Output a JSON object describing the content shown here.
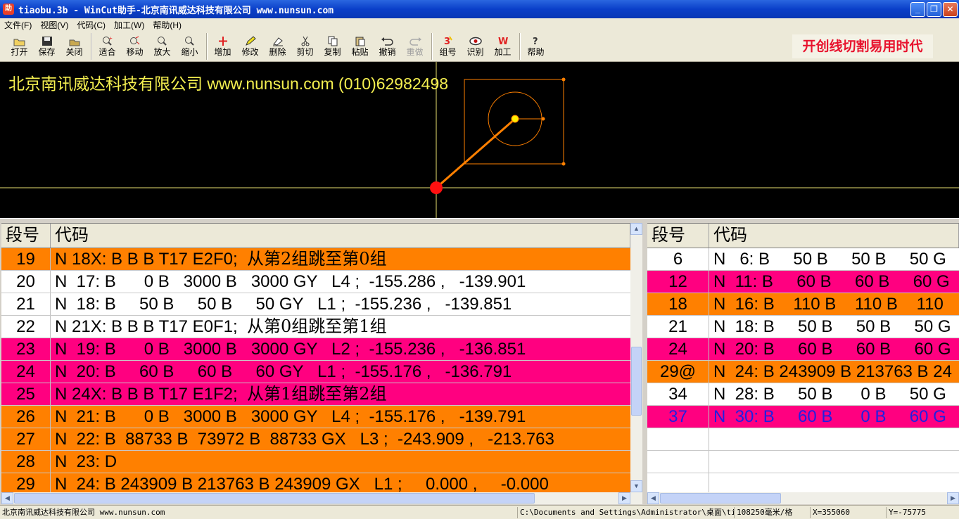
{
  "titlebar": {
    "app_icon": "app-icon",
    "title": "tiaobu.3b - WinCut助手-北京南讯威达科技有限公司 www.nunsun.com",
    "minimize_icon": "minimize-icon",
    "maximize_icon": "restore-icon",
    "close_icon": "close-icon"
  },
  "menu": {
    "items": [
      "文件(F)",
      "视图(V)",
      "代码(C)",
      "加工(W)",
      "帮助(H)"
    ]
  },
  "toolbar": {
    "groups": [
      [
        {
          "label": "打开",
          "icon": "open-folder-icon",
          "enabled": true
        },
        {
          "label": "保存",
          "icon": "save-disk-icon",
          "enabled": true
        },
        {
          "label": "关闭",
          "icon": "close-file-icon",
          "enabled": true
        }
      ],
      [
        {
          "label": "适合",
          "icon": "zoom-fit-icon",
          "enabled": true
        },
        {
          "label": "移动",
          "icon": "pan-hand-icon",
          "enabled": true
        },
        {
          "label": "放大",
          "icon": "zoom-in-icon",
          "enabled": true
        },
        {
          "label": "缩小",
          "icon": "zoom-out-icon",
          "enabled": true
        }
      ],
      [
        {
          "label": "增加",
          "icon": "add-plus-icon",
          "enabled": true
        },
        {
          "label": "修改",
          "icon": "edit-pencil-icon",
          "enabled": true
        },
        {
          "label": "删除",
          "icon": "eraser-icon",
          "enabled": true
        },
        {
          "label": "剪切",
          "icon": "scissors-icon",
          "enabled": true
        },
        {
          "label": "复制",
          "icon": "copy-icon",
          "enabled": true
        },
        {
          "label": "粘贴",
          "icon": "paste-icon",
          "enabled": true
        },
        {
          "label": "撤销",
          "icon": "undo-icon",
          "enabled": true
        },
        {
          "label": "重做",
          "icon": "redo-icon",
          "enabled": false
        }
      ],
      [
        {
          "label": "组号",
          "icon": "group-number-icon",
          "enabled": true
        },
        {
          "label": "识别",
          "icon": "eye-icon",
          "enabled": true
        },
        {
          "label": "加工",
          "icon": "machining-w-icon",
          "enabled": true
        }
      ],
      [
        {
          "label": "帮助",
          "icon": "help-question-icon",
          "enabled": true
        }
      ]
    ],
    "slogan": "开创线切割易用时代"
  },
  "canvas": {
    "banner": "北京南讯威达科技有限公司 www.nunsun.com (010)62982498",
    "colors": {
      "background": "#000000",
      "axis": "#f5f050",
      "path": "#ff8000",
      "start_point": "#ff1010",
      "current_point": "#ffee00"
    }
  },
  "left_table": {
    "headers": {
      "no": "段号",
      "code": "代码"
    },
    "rows": [
      {
        "no": "19",
        "code": "N 18X: B B B T17 E2F0;  ",
        "note": "从第2组跳至第0组",
        "color": "orange"
      },
      {
        "no": "20",
        "code": "N  17: B      0 B   3000 B   3000 GY   L4 ;  -155.286 ,   -139.901",
        "note": "",
        "color": "white"
      },
      {
        "no": "21",
        "code": "N  18: B     50 B     50 B     50 GY   L1 ;  -155.236 ,   -139.851",
        "note": "",
        "color": "white"
      },
      {
        "no": "22",
        "code": "N 21X: B B B T17 E0F1;  ",
        "note": "从第0组跳至第1组",
        "color": "white"
      },
      {
        "no": "23",
        "code": "N  19: B      0 B   3000 B   3000 GY   L2 ;  -155.236 ,   -136.851",
        "note": "",
        "color": "magenta"
      },
      {
        "no": "24",
        "code": "N  20: B     60 B     60 B     60 GY   L1 ;  -155.176 ,   -136.791",
        "note": "",
        "color": "magenta"
      },
      {
        "no": "25",
        "code": "N 24X: B B B T17 E1F2;  ",
        "note": "从第1组跳至第2组",
        "color": "magenta"
      },
      {
        "no": "26",
        "code": "N  21: B      0 B   3000 B   3000 GY   L4 ;  -155.176 ,   -139.791",
        "note": "",
        "color": "orange"
      },
      {
        "no": "27",
        "code": "N  22: B  88733 B  73972 B  88733 GX   L3 ;  -243.909 ,   -213.763",
        "note": "",
        "color": "orange"
      },
      {
        "no": "28",
        "code": "N  23: D",
        "note": "",
        "color": "orange"
      },
      {
        "no": "29",
        "code": "N  24: B 243909 B 213763 B 243909 GX   L1 ;     0.000 ,     -0.000",
        "note": "",
        "color": "orange"
      }
    ]
  },
  "right_table": {
    "headers": {
      "no": "段号",
      "code": "代码"
    },
    "rows": [
      {
        "no": "6",
        "code": "N   6: B     50 B     50 B     50 G",
        "color": "white"
      },
      {
        "no": "12",
        "code": "N  11: B     60 B     60 B     60 G",
        "color": "magenta"
      },
      {
        "no": "18",
        "code": "N  16: B    110 B    110 B    110",
        "color": "orange"
      },
      {
        "no": "21",
        "code": "N  18: B     50 B     50 B     50 G",
        "color": "white"
      },
      {
        "no": "24",
        "code": "N  20: B     60 B     60 B     60 G",
        "color": "magenta"
      },
      {
        "no": "29@",
        "code": "N  24: B 243909 B 213763 B 24",
        "color": "orange"
      },
      {
        "no": "34",
        "code": "N  28: B     50 B      0 B     50 G",
        "color": "white"
      },
      {
        "no": "37",
        "code": "N  30: B     60 B      0 B     60 G",
        "color": "magenta-blue"
      },
      {
        "no": "",
        "code": "",
        "color": "white"
      },
      {
        "no": "",
        "code": "",
        "color": "white"
      },
      {
        "no": "",
        "code": "",
        "color": "white"
      }
    ]
  },
  "statusbar": {
    "company": "北京南讯威达科技有限公司 www.nunsun.com",
    "path": "C:\\Documents and Settings\\Administrator\\桌面\\tiaobu",
    "scale": "108250毫米/格",
    "x": "X=355060",
    "y": "Y=-75775"
  }
}
